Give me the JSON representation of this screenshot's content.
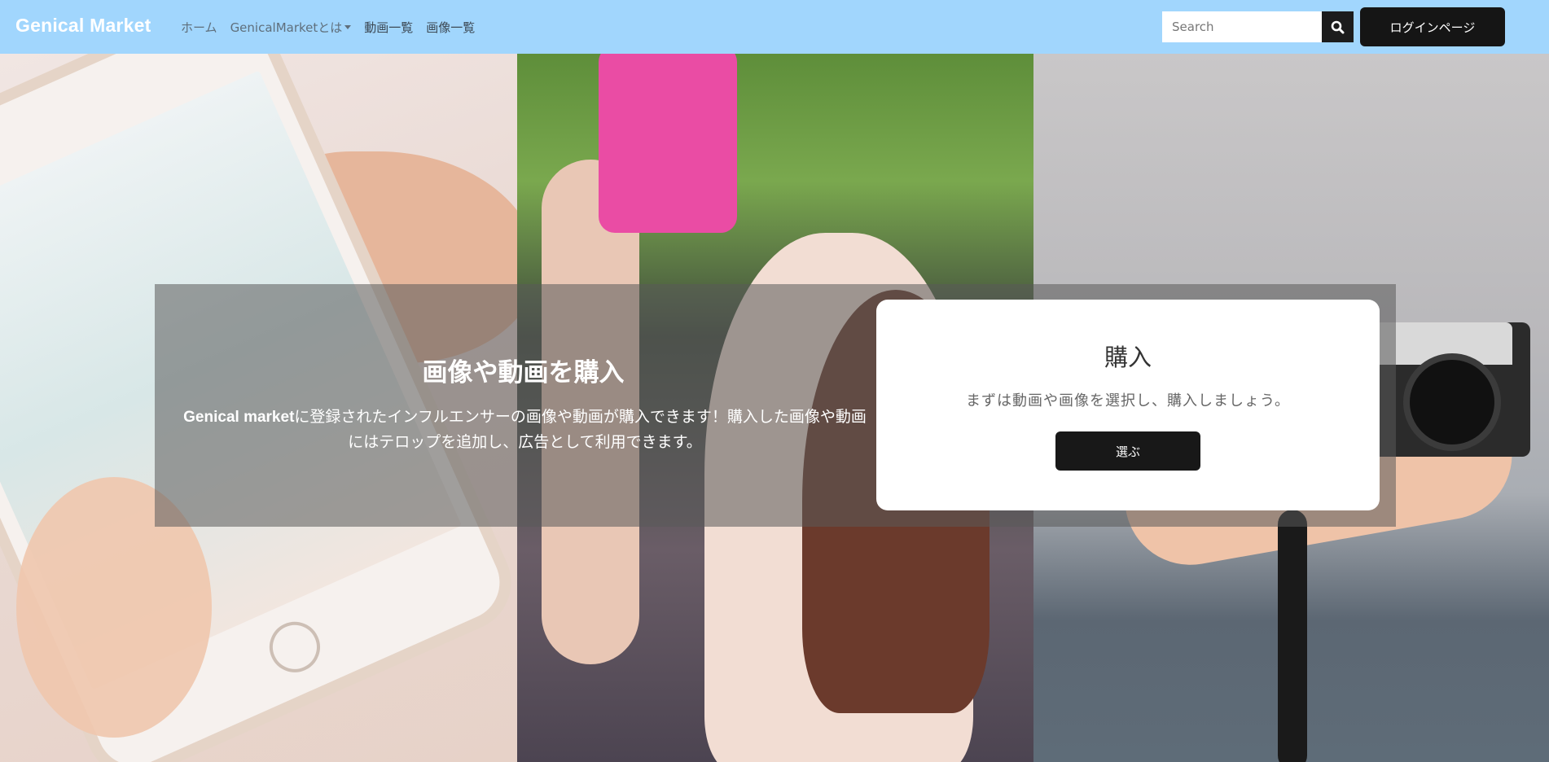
{
  "navbar": {
    "brand": "Genical Market",
    "links": [
      {
        "label": "ホーム"
      },
      {
        "label": "GenicalMarketとは"
      },
      {
        "label": "動画一覧"
      },
      {
        "label": "画像一覧"
      }
    ],
    "search": {
      "placeholder": "Search",
      "icon": "search-icon"
    },
    "login_label": "ログインページ"
  },
  "hero": {
    "title": "画像や動画を購入",
    "description_brand": "Genical market",
    "description_rest": "に登録されたインフルエンサーの画像や動画が購入できます！購入した画像や動画にはテロップを追加し、広告として利用できます。"
  },
  "card": {
    "title": "購入",
    "text": "まずは動画や画像を選択し、購入しましょう。",
    "button_label": "選ぶ"
  },
  "colors": {
    "navbar_bg": "#a1d6fd",
    "button_dark": "#151515"
  }
}
